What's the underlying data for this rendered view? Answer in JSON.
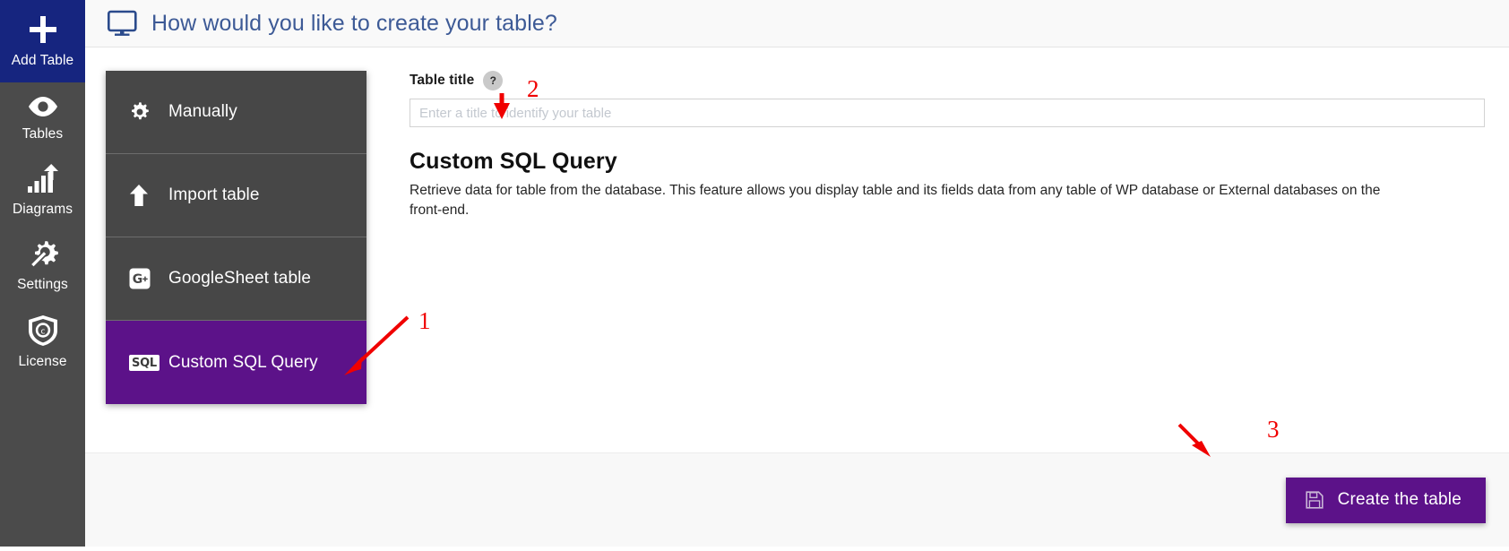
{
  "sidebar": {
    "items": [
      {
        "label": "Add Table",
        "icon": "plus-icon",
        "active": true
      },
      {
        "label": "Tables",
        "icon": "eye-icon",
        "active": false
      },
      {
        "label": "Diagrams",
        "icon": "bar-chart-arrow-icon",
        "active": false
      },
      {
        "label": "Settings",
        "icon": "gear-wrench-icon",
        "active": false
      },
      {
        "label": "License",
        "icon": "shield-copyright-icon",
        "active": false
      }
    ]
  },
  "header": {
    "icon": "monitor-icon",
    "title": "How would you like to create your table?"
  },
  "tiles": [
    {
      "label": "Manually",
      "icon": "gear-icon",
      "selected": false
    },
    {
      "label": "Import table",
      "icon": "upload-arrow-icon",
      "selected": false
    },
    {
      "label": "GoogleSheet table",
      "icon": "google-plus-icon",
      "selected": false
    },
    {
      "label": "Custom SQL Query",
      "icon": "sql-badge-icon",
      "icon_text": "SQL",
      "selected": true
    }
  ],
  "form": {
    "title_label": "Table title",
    "help_badge": "?",
    "title_value": "",
    "title_placeholder": "Enter a title to identify your table"
  },
  "section": {
    "heading": "Custom SQL Query",
    "description": "Retrieve data for table from the database. This feature allows you display table and its fields data from any table of WP database or External databases on the front-end."
  },
  "footer": {
    "create_label": "Create the table",
    "create_icon": "save-floppy-icon"
  },
  "annotations": [
    {
      "number": "1",
      "target": "custom-sql-query-tile"
    },
    {
      "number": "2",
      "target": "table-title-input"
    },
    {
      "number": "3",
      "target": "create-the-table-button"
    }
  ],
  "colors": {
    "sidebar_bg": "#4b4b4b",
    "sidebar_active": "#16257f",
    "tile_bg": "#474747",
    "accent_purple": "#5c1289",
    "header_text": "#3d5a96",
    "annotation_red": "#f00000"
  }
}
